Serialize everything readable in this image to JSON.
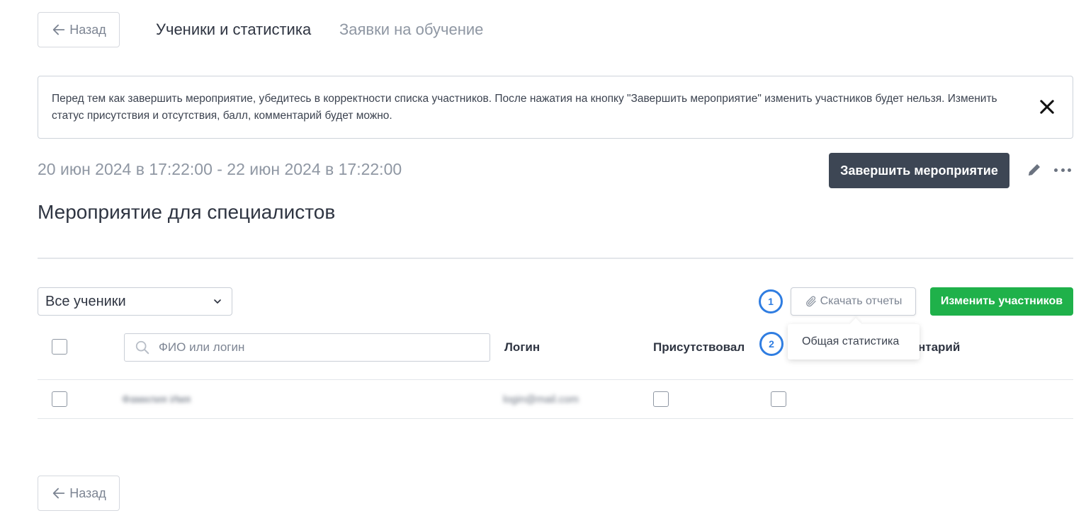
{
  "header": {
    "back_label": "Назад",
    "tabs": [
      {
        "label": "Ученики и статистика"
      },
      {
        "label": "Заявки на обучение"
      }
    ]
  },
  "notice": {
    "text": "Перед тем как завершить мероприятие, убедитесь в корректности списка участников. После нажатия на кнопку \"Завершить мероприятие\" изменить участников будет нельзя. Изменить статус присутствия и отсутствия, балл, комментарий будет можно."
  },
  "event": {
    "date_range": "20 июн 2024 в 17:22:00 - 22 июн 2024 в 17:22:00",
    "finish_label": "Завершить мероприятие",
    "title": "Мероприятие для специалистов"
  },
  "toolbar": {
    "filter_value": "Все ученики",
    "download_label": "Скачать отчеты",
    "change_label": "Изменить участников",
    "dropdown_items": [
      "Общая статистика"
    ]
  },
  "annotations": {
    "marker_1": "1",
    "marker_2": "2"
  },
  "table": {
    "search_placeholder": "ФИО или логин",
    "columns": {
      "login": "Логин",
      "attended": "Присутствовал",
      "comment_partial": "нтарий"
    },
    "rows": [
      {
        "name": "Фамилия Имя",
        "login": "login@mail.com"
      }
    ]
  },
  "footer": {
    "back_label": "Назад"
  },
  "colors": {
    "primary_dark": "#3d4654",
    "success": "#1fb14a",
    "annotation_blue": "#2f7de1",
    "muted_text": "#8f97a3"
  }
}
